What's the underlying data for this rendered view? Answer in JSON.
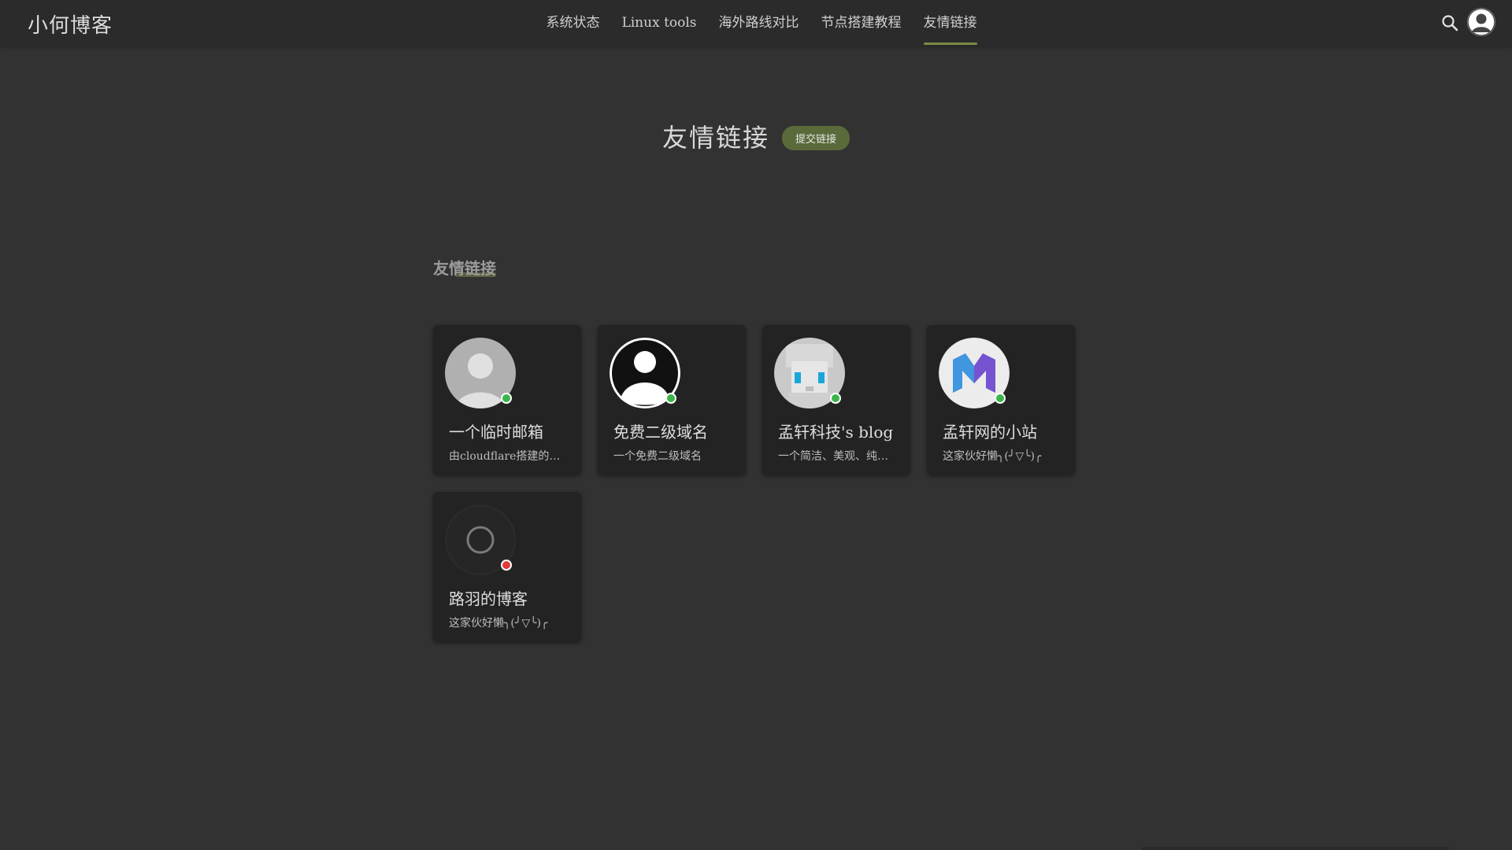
{
  "header": {
    "brand": "小何博客",
    "nav": [
      {
        "label": "系统状态",
        "active": false
      },
      {
        "label": "Linux tools",
        "active": false
      },
      {
        "label": "海外路线对比",
        "active": false
      },
      {
        "label": "节点搭建教程",
        "active": false
      },
      {
        "label": "友情链接",
        "active": true
      }
    ],
    "icons": {
      "search": "search-icon",
      "user": "user-avatar-icon"
    }
  },
  "page": {
    "title": "友情链接",
    "submit_label": "提交链接"
  },
  "section": {
    "title": "友情链接"
  },
  "links": [
    {
      "name": "一个临时邮箱",
      "desc": "由cloudflare搭建的临时邮箱",
      "status": "online",
      "avatar": "default-person"
    },
    {
      "name": "免费二级域名",
      "desc": "一个免费二级域名",
      "status": "online",
      "avatar": "default-person-dark"
    },
    {
      "name": "孟轩科技's blog",
      "desc": "一个简洁、美观、纯粹的博客",
      "status": "online",
      "avatar": "pixel-character"
    },
    {
      "name": "孟轩网的小站",
      "desc": "这家伙好懒╮(╯▽╰)╭",
      "status": "online",
      "avatar": "m-logo"
    },
    {
      "name": "路羽的博客",
      "desc": "这家伙好懒╮(╯▽╰)╭",
      "status": "offline",
      "avatar": "loading"
    }
  ],
  "colors": {
    "online": "#3bb54a",
    "offline": "#e03a3a",
    "accent": "#7a8a4a",
    "button": "#5a6a3a"
  }
}
